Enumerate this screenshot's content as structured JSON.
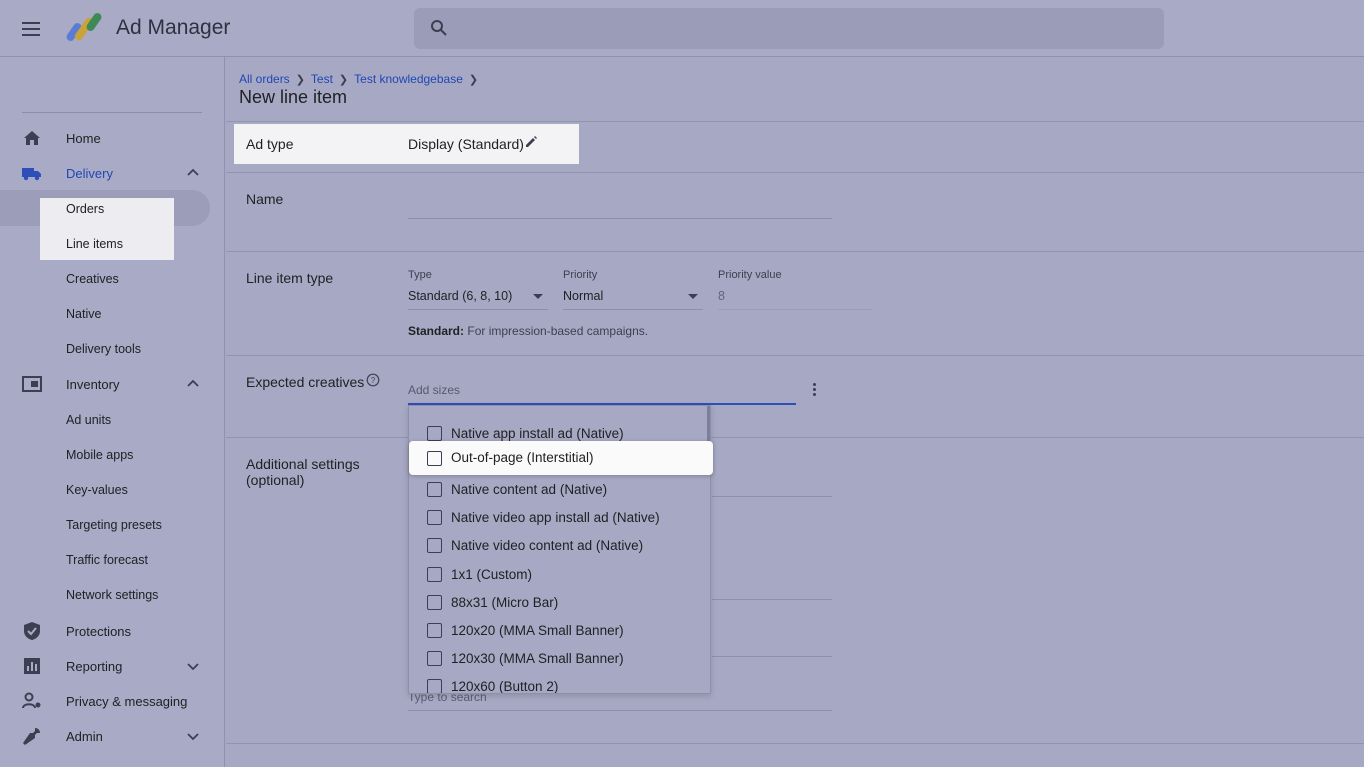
{
  "app": {
    "title": "Ad Manager"
  },
  "search": {
    "placeholder": ""
  },
  "sidebar": {
    "home": "Home",
    "delivery": "Delivery",
    "delivery_sub": [
      "Orders",
      "Line items",
      "Creatives",
      "Native",
      "Delivery tools"
    ],
    "inventory": "Inventory",
    "inventory_sub": [
      "Ad units",
      "Mobile apps",
      "Key-values",
      "Targeting presets",
      "Traffic forecast",
      "Network settings"
    ],
    "protections": "Protections",
    "reporting": "Reporting",
    "privacy": "Privacy & messaging",
    "admin": "Admin"
  },
  "breadcrumb": [
    "All orders",
    "Test",
    "Test knowledgebase"
  ],
  "page_title": "New line item",
  "ad_type": {
    "label": "Ad type",
    "value": "Display (Standard)"
  },
  "name": {
    "label": "Name"
  },
  "line_item_type": {
    "label": "Line item type",
    "type_label": "Type",
    "type_value": "Standard (6, 8, 10)",
    "priority_label": "Priority",
    "priority_value": "Normal",
    "priority_value_label": "Priority value",
    "priority_value_value": "8",
    "note_bold": "Standard:",
    "note_text": "For impression-based campaigns."
  },
  "expected_creatives": {
    "label": "Expected creatives",
    "placeholder": "Add sizes"
  },
  "additional_settings": {
    "label_line1": "Additional settings",
    "label_line2": "(optional)",
    "type_to_search": "Type to search"
  },
  "dropdown": {
    "options": [
      "Native app install ad (Native)",
      "Out-of-page (Interstitial)",
      "Native content ad (Native)",
      "Native video app install ad (Native)",
      "Native video content ad (Native)",
      "1x1 (Custom)",
      "88x31 (Micro Bar)",
      "120x20 (MMA Small Banner)",
      "120x30 (MMA Small Banner)",
      "120x60 (Button 2)"
    ],
    "highlighted_index": 1
  },
  "colors": {
    "accent": "#1f47b5",
    "background": "#a7a9c4"
  }
}
